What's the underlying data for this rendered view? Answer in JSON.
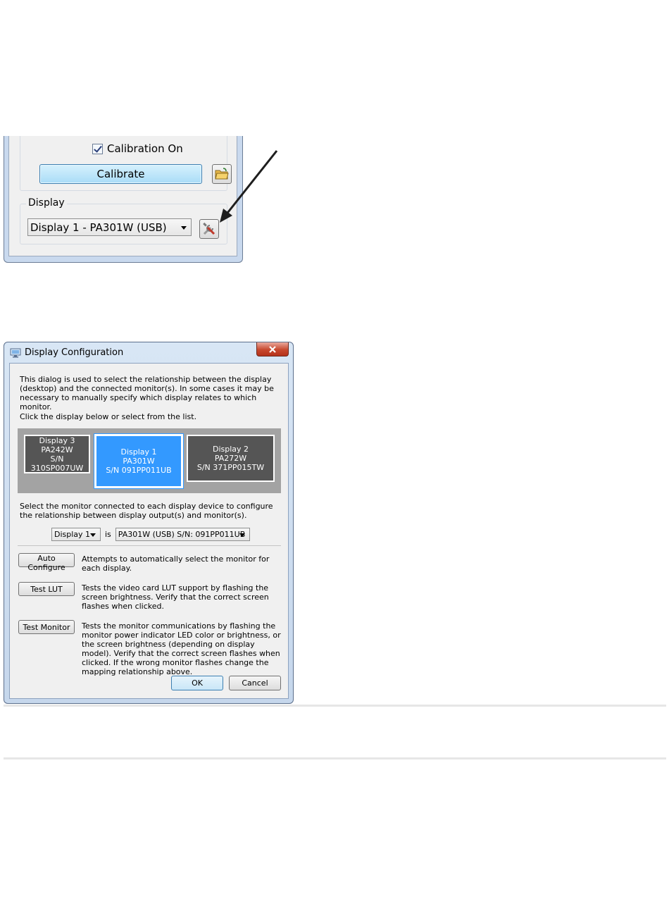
{
  "app_panel": {
    "calibration_checkbox_label": "Calibration On",
    "calibration_checked": true,
    "calibrate_button_label": "Calibrate",
    "display_group_label": "Display",
    "display_select_value": "Display 1 - PA301W (USB)"
  },
  "dialog": {
    "title": "Display Configuration",
    "intro_text": "This dialog is used to select the relationship between the display (desktop) and the connected monitor(s). In some cases it may be necessary to manually specify which display relates to which monitor.",
    "click_instruction": "Click the display below or select from the list.",
    "displays": [
      {
        "name": "Display 3",
        "model": "PA242W",
        "serial": "S/N 310SP007UW"
      },
      {
        "name": "Display 1",
        "model": "PA301W",
        "serial": "S/N 091PP011UB",
        "selected": true
      },
      {
        "name": "Display 2",
        "model": "PA272W",
        "serial": "S/N 371PP015TW"
      }
    ],
    "select_instruction": "Select the monitor connected to each display device to configure the relationship between display output(s) and monitor(s).",
    "mapping": {
      "display_value": "Display 1",
      "is_label": "is",
      "monitor_value": "PA301W (USB) S/N: 091PP011UB"
    },
    "actions": [
      {
        "label": "Auto Configure",
        "description": "Attempts to automatically select the monitor for each display."
      },
      {
        "label": "Test LUT",
        "description": "Tests the video card LUT support by flashing the screen brightness. Verify that the correct screen flashes when clicked."
      },
      {
        "label": "Test Monitor",
        "description": "Tests the monitor communications by flashing the monitor power indicator LED color or brightness, or the screen brightness (depending on display model). Verify that the correct screen flashes when clicked. If the wrong monitor flashes change the mapping relationship above."
      }
    ],
    "ok_label": "OK",
    "cancel_label": "Cancel"
  },
  "colors": {
    "selected_display": "#3399ff",
    "unselected_display": "#555555",
    "close_button": "#c7482e"
  },
  "icons": [
    "checkbox-checked-icon",
    "open-folder-icon",
    "tools-icon",
    "pointer-arrow",
    "dialog-monitor-icon",
    "close-x-icon"
  ]
}
